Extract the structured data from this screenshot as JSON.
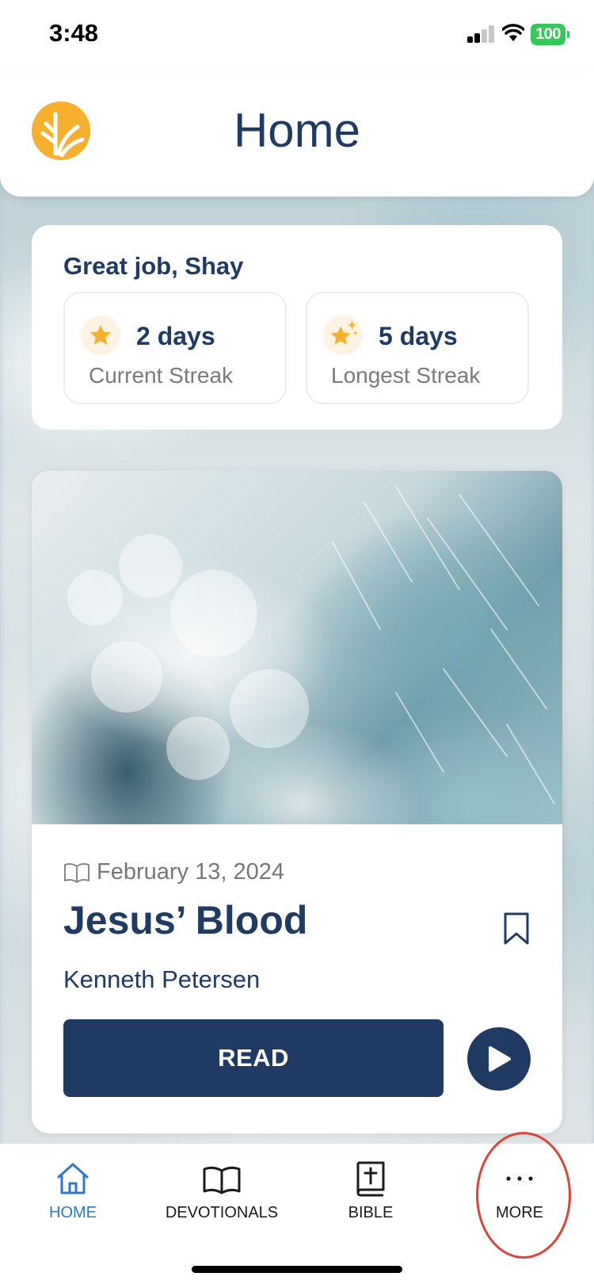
{
  "status_bar": {
    "time": "3:48",
    "battery": "100"
  },
  "header": {
    "title": "Home"
  },
  "streak": {
    "greeting": "Great job, Shay",
    "current": {
      "value": "2 days",
      "label": "Current Streak"
    },
    "longest": {
      "value": "5 days",
      "label": "Longest Streak"
    }
  },
  "devotional": {
    "date": "February 13, 2024",
    "title": "Jesus’ Blood",
    "author": "Kenneth Petersen",
    "read_label": "READ"
  },
  "tabs": [
    {
      "label": "HOME",
      "icon": "home-icon",
      "active": true
    },
    {
      "label": "DEVOTIONALS",
      "icon": "open-book-icon"
    },
    {
      "label": "BIBLE",
      "icon": "bible-icon"
    },
    {
      "label": "MORE",
      "icon": "more-icon"
    }
  ],
  "colors": {
    "navy": "#1f3a63",
    "accent_blue": "#2d78c7",
    "gold": "#f6b02e",
    "highlight_red": "#d9453a"
  }
}
